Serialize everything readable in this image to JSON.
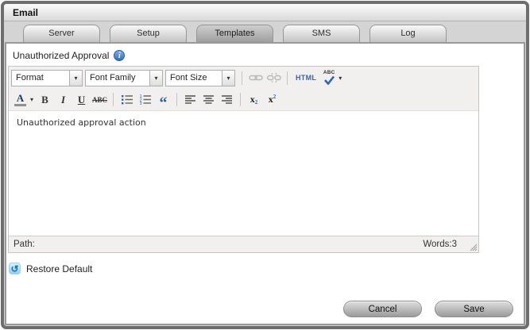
{
  "window": {
    "title": "Email"
  },
  "tabs": [
    {
      "label": "Server",
      "active": false
    },
    {
      "label": "Setup",
      "active": false
    },
    {
      "label": "Templates",
      "active": true
    },
    {
      "label": "SMS",
      "active": false
    },
    {
      "label": "Log",
      "active": false
    }
  ],
  "panel": {
    "field_label": "Unauthorized Approval",
    "info_icon_glyph": "i"
  },
  "editor": {
    "toolbar_row1": {
      "format_select": "Format",
      "font_family_select": "Font Family",
      "font_size_select": "Font Size",
      "html_button_label": "HTML",
      "spellcheck_label": "ABC"
    },
    "toolbar_row2": {
      "forecolor_label": "A",
      "bold_label": "B",
      "italic_label": "I",
      "underline_label": "U",
      "strikethrough_label": "ABC",
      "blockquote_glyph": "“",
      "subscript_base": "x",
      "subscript_digit": "2",
      "superscript_base": "x",
      "superscript_digit": "2"
    },
    "content_text": "Unauthorized approval action",
    "statusbar": {
      "path_label": "Path:",
      "words_label": "Words:3"
    }
  },
  "actions": {
    "restore_default_label": "Restore Default",
    "restore_icon_glyph": "↺",
    "cancel_label": "Cancel",
    "save_label": "Save"
  },
  "colors": {
    "accent_blue": "#2d5fb0",
    "info_icon_blue": "#3b74c9",
    "window_border": "#6e6e6e",
    "active_tab_gray": "#a8a8a8"
  }
}
